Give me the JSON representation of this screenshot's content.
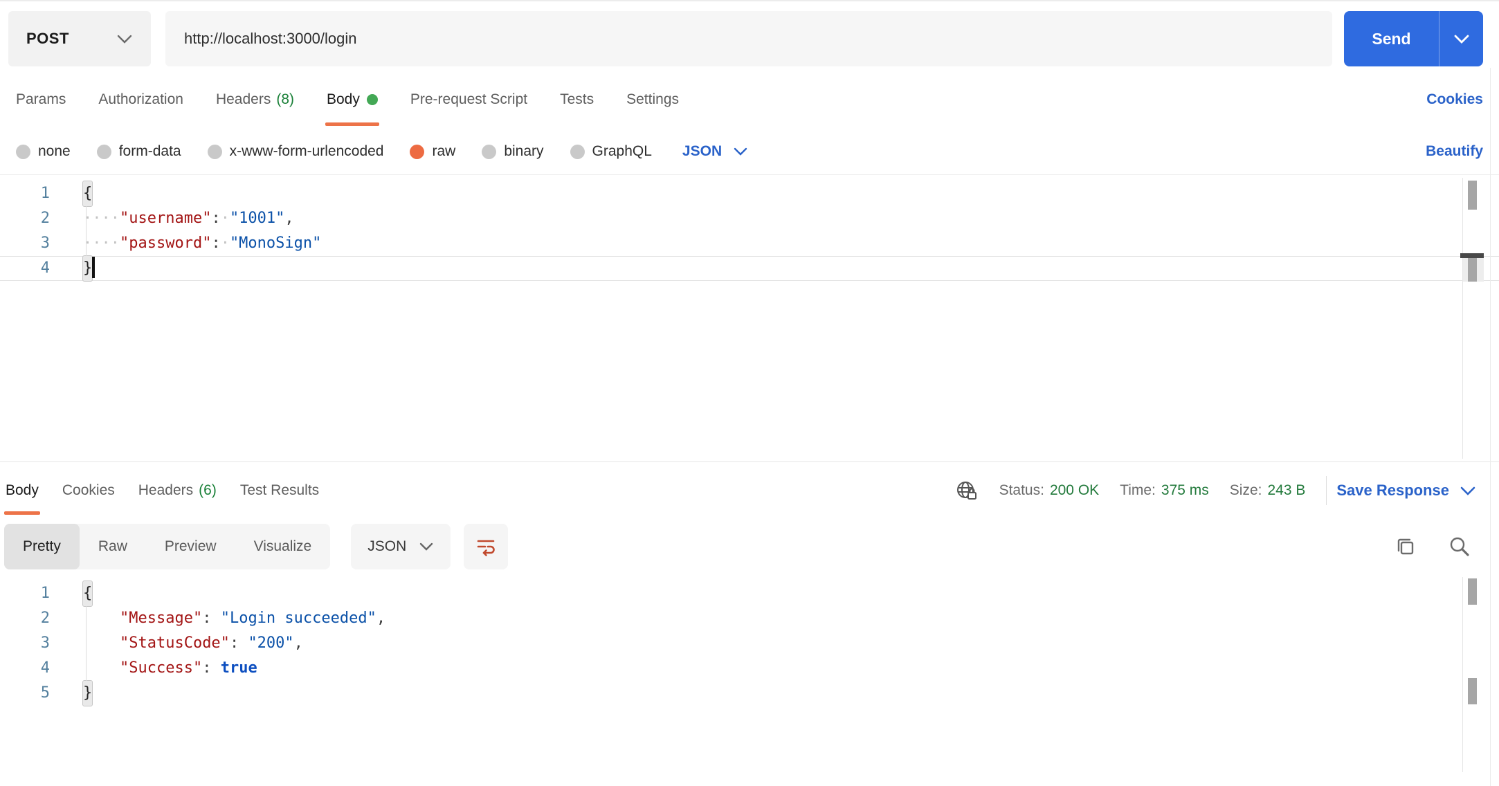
{
  "colors": {
    "accent_orange": "#ED7348",
    "radio_selected_orange": "#ED6B42",
    "link_blue": "#2A62C9",
    "send_blue": "#2F6BE0",
    "count_green": "#1A8038",
    "status_green": "#237A3C",
    "dot_green": "#43A855",
    "code_key_red": "#A31515",
    "code_string_blue": "#0B51A8",
    "gutter_teal": "#54809E",
    "wrap_icon_brick": "#C14A2E"
  },
  "request_bar": {
    "method": "POST",
    "url": "http://localhost:3000/login",
    "send_label": "Send"
  },
  "request_tabs": {
    "items": [
      {
        "label": "Params"
      },
      {
        "label": "Authorization"
      },
      {
        "label": "Headers",
        "count": "(8)"
      },
      {
        "label": "Body",
        "active": true,
        "dot": true
      },
      {
        "label": "Pre-request Script"
      },
      {
        "label": "Tests"
      },
      {
        "label": "Settings"
      }
    ],
    "cookies_link": "Cookies"
  },
  "body_type_row": {
    "options": [
      {
        "label": "none"
      },
      {
        "label": "form-data"
      },
      {
        "label": "x-www-form-urlencoded"
      },
      {
        "label": "raw",
        "selected": true
      },
      {
        "label": "binary"
      },
      {
        "label": "GraphQL"
      }
    ],
    "language": "JSON",
    "beautify_link": "Beautify"
  },
  "request_editor": {
    "lines": [
      {
        "num": "1",
        "tokens": [
          {
            "type": "bracket",
            "text": "{"
          }
        ]
      },
      {
        "num": "2",
        "tokens": [
          {
            "type": "ws",
            "text": "····"
          },
          {
            "type": "key",
            "text": "\"username\""
          },
          {
            "type": "punct",
            "text": ":"
          },
          {
            "type": "ws",
            "text": "·"
          },
          {
            "type": "str",
            "text": "\"1001\""
          },
          {
            "type": "punct",
            "text": ","
          }
        ]
      },
      {
        "num": "3",
        "tokens": [
          {
            "type": "ws",
            "text": "····"
          },
          {
            "type": "key",
            "text": "\"password\""
          },
          {
            "type": "punct",
            "text": ":"
          },
          {
            "type": "ws",
            "text": "·"
          },
          {
            "type": "str",
            "text": "\"MonoSign\""
          }
        ]
      },
      {
        "num": "4",
        "current": true,
        "tokens": [
          {
            "type": "bracket",
            "text": "}"
          },
          {
            "type": "cursor"
          }
        ]
      }
    ]
  },
  "response_head": {
    "tabs": [
      {
        "label": "Body",
        "active": true
      },
      {
        "label": "Cookies"
      },
      {
        "label": "Headers",
        "count": "(6)"
      },
      {
        "label": "Test Results"
      }
    ],
    "stats": [
      {
        "label": "Status:",
        "value": "200 OK"
      },
      {
        "label": "Time:",
        "value": "375 ms"
      },
      {
        "label": "Size:",
        "value": "243 B"
      }
    ],
    "save_response_label": "Save Response"
  },
  "response_toolbar": {
    "views": [
      {
        "label": "Pretty",
        "active": true
      },
      {
        "label": "Raw"
      },
      {
        "label": "Preview"
      },
      {
        "label": "Visualize"
      }
    ],
    "language": "JSON"
  },
  "response_editor": {
    "lines": [
      {
        "num": "1",
        "tokens": [
          {
            "type": "bracket",
            "text": "{"
          }
        ]
      },
      {
        "num": "2",
        "tokens": [
          {
            "type": "punct",
            "text": "    "
          },
          {
            "type": "key",
            "text": "\"Message\""
          },
          {
            "type": "punct",
            "text": ": "
          },
          {
            "type": "str",
            "text": "\"Login succeeded\""
          },
          {
            "type": "punct",
            "text": ","
          }
        ]
      },
      {
        "num": "3",
        "tokens": [
          {
            "type": "punct",
            "text": "    "
          },
          {
            "type": "key",
            "text": "\"StatusCode\""
          },
          {
            "type": "punct",
            "text": ": "
          },
          {
            "type": "str",
            "text": "\"200\""
          },
          {
            "type": "punct",
            "text": ","
          }
        ]
      },
      {
        "num": "4",
        "tokens": [
          {
            "type": "punct",
            "text": "    "
          },
          {
            "type": "key",
            "text": "\"Success\""
          },
          {
            "type": "punct",
            "text": ": "
          },
          {
            "type": "bool",
            "text": "true"
          }
        ]
      },
      {
        "num": "5",
        "tokens": [
          {
            "type": "bracket",
            "text": "}"
          }
        ]
      }
    ]
  },
  "icons": {
    "method_chevron": "chevron-down",
    "send_chevron": "chevron-down",
    "lang_chevron": "chevron-down",
    "save_chevron": "chevron-down",
    "globe": "globe-lock",
    "wrap": "text-wrap",
    "copy": "copy",
    "search": "magnifier"
  }
}
